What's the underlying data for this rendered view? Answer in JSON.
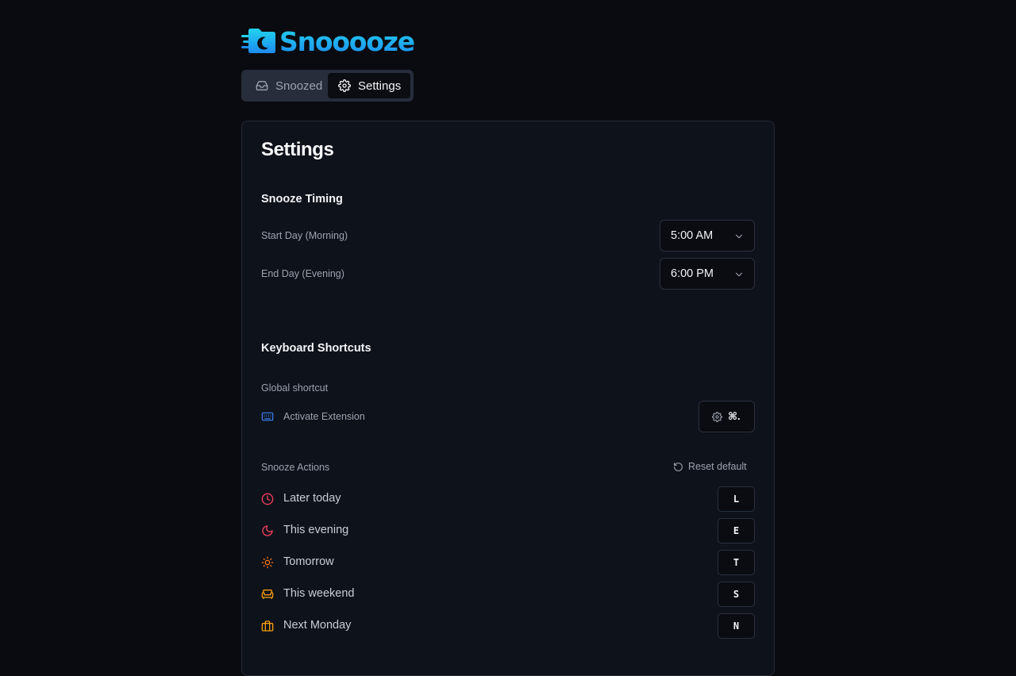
{
  "app": {
    "name": "Snooooze",
    "logo_icon": "snooze-folder-moon-icon"
  },
  "tabs": [
    {
      "label": "Snoozed",
      "icon": "inbox-icon",
      "active": false
    },
    {
      "label": "Settings",
      "icon": "gear-icon",
      "active": true
    }
  ],
  "settings": {
    "title": "Settings",
    "timing": {
      "title": "Snooze Timing",
      "start_label": "Start Day (Morning)",
      "start_value": "5:00 AM",
      "end_label": "End Day (Evening)",
      "end_value": "6:00 PM"
    },
    "shortcuts": {
      "title": "Keyboard Shortcuts",
      "global_label": "Global shortcut",
      "activate_label": "Activate Extension",
      "activate_icon": "keyboard-icon",
      "activate_keys": "⌘.",
      "activate_key_icon": "gear-icon"
    },
    "actions": {
      "title": "Snooze Actions",
      "reset_label": "Reset default",
      "reset_icon": "reset-icon",
      "items": [
        {
          "label": "Later today",
          "key": "L",
          "icon": "clock-icon",
          "color": "#f43f5e"
        },
        {
          "label": "This evening",
          "key": "E",
          "icon": "moon-icon",
          "color": "#f43f5e"
        },
        {
          "label": "Tomorrow",
          "key": "T",
          "icon": "sun-icon",
          "color": "#f97316"
        },
        {
          "label": "This weekend",
          "key": "S",
          "icon": "sofa-icon",
          "color": "#f59e0b"
        },
        {
          "label": "Next Monday",
          "key": "N",
          "icon": "briefcase-icon",
          "color": "#f59e0b"
        }
      ]
    }
  },
  "colors": {
    "background": "#0a0b10",
    "panel": "#0e121b",
    "accent_gradient_start": "#22d3ee",
    "accent_gradient_end": "#1d8cf0",
    "keyboard_icon": "#3b82f6"
  }
}
